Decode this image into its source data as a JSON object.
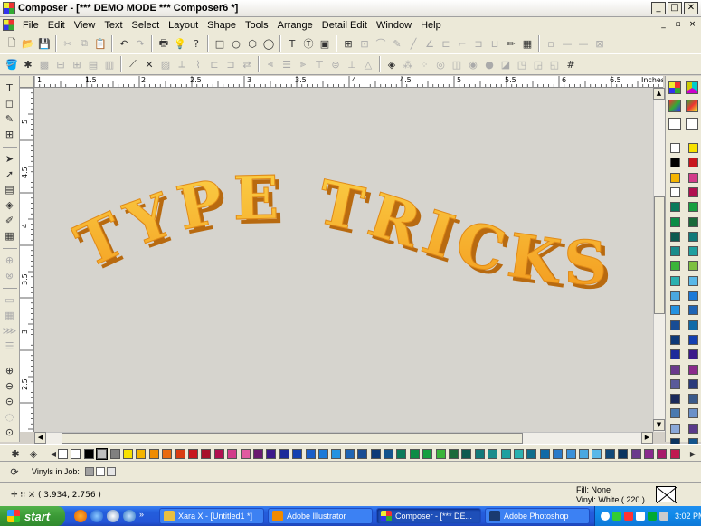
{
  "window": {
    "title": "Composer - [*** DEMO MODE *** Composer6 *]",
    "min": "_",
    "max": "□",
    "close": "✕"
  },
  "menu": {
    "items": [
      "File",
      "Edit",
      "View",
      "Text",
      "Select",
      "Layout",
      "Shape",
      "Tools",
      "Arrange",
      "Detail Edit",
      "Window",
      "Help"
    ],
    "mdi_min": "_",
    "mdi_restore": "▫",
    "mdi_close": "×"
  },
  "ruler": {
    "units": "Inches",
    "top_labels": [
      "1",
      "1.5",
      "2",
      "2.5",
      "3",
      "3.5",
      "4",
      "4.5",
      "5",
      "5.5",
      "6",
      "6.5"
    ],
    "left_labels": [
      "5",
      "4.5",
      "4",
      "3.5",
      "3",
      "2.5"
    ]
  },
  "canvas": {
    "artwork_text": "TYPE TRICKS",
    "fill_top": "#fbd046",
    "fill_bottom": "#f39a1e",
    "shadow": "#b86a10"
  },
  "vinyls": {
    "label": "Vinyls in Job:"
  },
  "status": {
    "coords": "( 3.934, 2.756 )",
    "fill": "Fill: None",
    "vinyl": "Vinyl: White ( 220 )"
  },
  "taskbar": {
    "start": "start",
    "tasks": [
      {
        "label": "Xara X - [Untitled1 *]",
        "active": false
      },
      {
        "label": "Adobe Illustrator",
        "active": false
      },
      {
        "label": "Composer - [*** DE...",
        "active": true
      },
      {
        "label": "Adobe Photoshop",
        "active": false
      }
    ],
    "clock": "3:02 PM"
  },
  "colors": {
    "palette": [
      "#ffffff",
      "#ffffff",
      "#000000",
      "#c0c0c0",
      "#808080",
      "#f7e100",
      "#f4b400",
      "#f08c00",
      "#e86a10",
      "#d83c12",
      "#c8161e",
      "#a8102a",
      "#b01050",
      "#d23c8a",
      "#e05aa0",
      "#6a1a70",
      "#3c1a8a",
      "#1c2a9a",
      "#1440b0",
      "#1a5ec8",
      "#1c7ad8",
      "#2492e0",
      "#1e64b4",
      "#184c94",
      "#0e3a78",
      "#14548c",
      "#0a7a5a",
      "#0c8c46",
      "#16a040",
      "#3ab43a",
      "#1a6a3a",
      "#0e5a50",
      "#127a7a",
      "#1a8c8c",
      "#20a0a0",
      "#2ab0b0",
      "#0e6e8c",
      "#106aa8",
      "#2a7ac8",
      "#3a90d8",
      "#4aa8e0",
      "#5ab8e8",
      "#104878",
      "#0a3460",
      "#6a3a8c",
      "#8a2a8c",
      "#a81a6a",
      "#c01a50"
    ],
    "side": [
      "#ffffff",
      "#f7e100",
      "#000000",
      "#c8161e",
      "#f4b400",
      "#d23c8a",
      "#ffffff",
      "#b01050",
      "#0a7a5a",
      "#16a040",
      "#0c8c46",
      "#1a6a3a",
      "#0e5a50",
      "#127a7a",
      "#1a8c8c",
      "#20a0a0",
      "#3ab43a",
      "#7cc040",
      "#2ab0b0",
      "#5ab8e8",
      "#4aa8e0",
      "#1c7ad8",
      "#2492e0",
      "#1e64b4",
      "#184c94",
      "#106aa8",
      "#0e3a78",
      "#1440b0",
      "#1c2a9a",
      "#3c1a8a",
      "#6a3a8c",
      "#8a2a8c",
      "#5a5a9a",
      "#2a3a7a",
      "#1a2a5a",
      "#3a5a8a",
      "#4a7ab0",
      "#6a90c8",
      "#8aa8d8",
      "#5a3a8a",
      "#0a3460",
      "#14548c"
    ]
  }
}
